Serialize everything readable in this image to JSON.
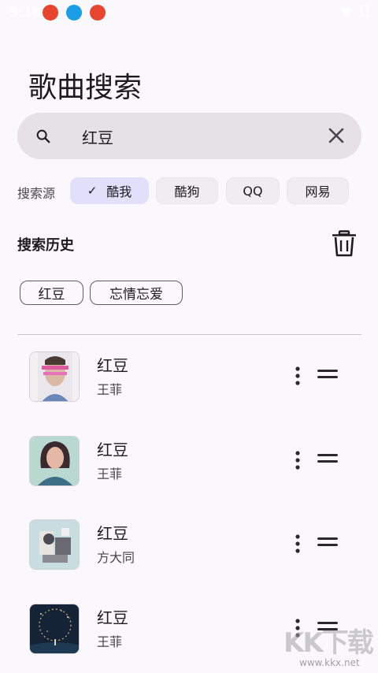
{
  "status_bar": {
    "time": "3:18"
  },
  "page_title": "歌曲搜索",
  "search": {
    "value": "红豆",
    "placeholder": ""
  },
  "sources": {
    "label": "搜索源",
    "chips": [
      {
        "label": "酷我",
        "selected": true
      },
      {
        "label": "酷狗",
        "selected": false
      },
      {
        "label": "QQ",
        "selected": false
      },
      {
        "label": "网易",
        "selected": false
      }
    ]
  },
  "history": {
    "title": "搜索历史",
    "tags": [
      "红豆",
      "忘情忘爱"
    ]
  },
  "results": [
    {
      "title": "红豆",
      "artist": "王菲",
      "cover": "portrait-pink"
    },
    {
      "title": "红豆",
      "artist": "王菲",
      "cover": "portrait-dark-hair"
    },
    {
      "title": "红豆",
      "artist": "方大同",
      "cover": "collage"
    },
    {
      "title": "红豆",
      "artist": "王菲",
      "cover": "night-sky"
    }
  ],
  "watermark": {
    "text": "KK下载",
    "url": "www.kkx.net"
  },
  "colors": {
    "background": "#fbf8fd",
    "search_bar": "#e6e1e6",
    "chip_selected": "#e1dffa",
    "chip": "#efedf2"
  }
}
